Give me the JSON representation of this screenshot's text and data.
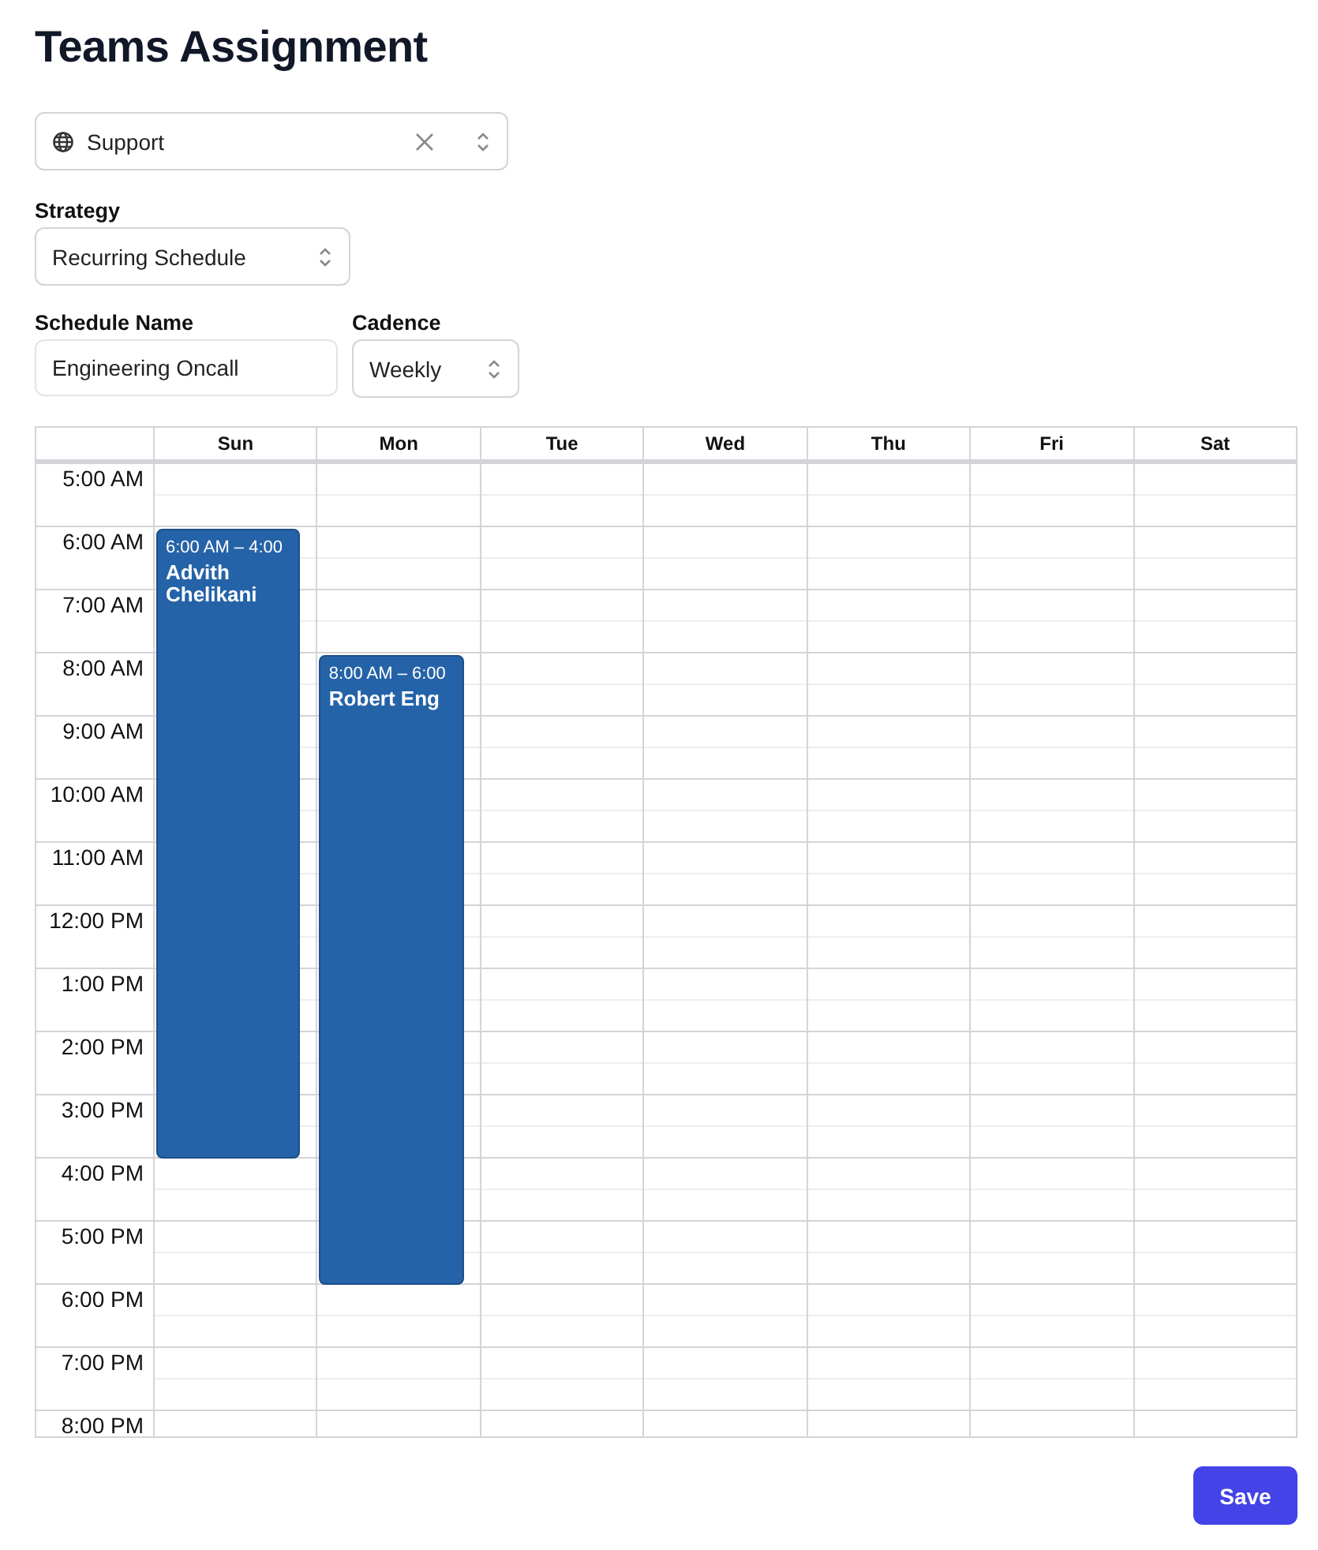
{
  "title": "Teams Assignment",
  "team_select": {
    "value": "Support"
  },
  "strategy": {
    "label": "Strategy",
    "value": "Recurring Schedule"
  },
  "schedule_name": {
    "label": "Schedule Name",
    "value": "Engineering Oncall"
  },
  "cadence": {
    "label": "Cadence",
    "value": "Weekly"
  },
  "calendar": {
    "hours": [
      "5:00 AM",
      "6:00 AM",
      "7:00 AM",
      "8:00 AM",
      "9:00 AM",
      "10:00 AM",
      "11:00 AM",
      "12:00 PM",
      "1:00 PM",
      "2:00 PM",
      "3:00 PM",
      "4:00 PM",
      "5:00 PM",
      "6:00 PM",
      "7:00 PM",
      "8:00 PM"
    ],
    "days": [
      {
        "label": "Sun",
        "slots": [
          {
            "kind": "free"
          },
          {
            "kind": "event",
            "time": "6:00 AM – 4:00",
            "name": "Advith Chelikani"
          },
          {
            "kind": "cont"
          },
          {
            "kind": "cont"
          },
          {
            "kind": "cont"
          },
          {
            "kind": "cont"
          },
          {
            "kind": "cont"
          },
          {
            "kind": "cont"
          },
          {
            "kind": "cont"
          },
          {
            "kind": "cont"
          },
          {
            "kind": "cont"
          }
        ]
      },
      {
        "label": "Mon",
        "slots": [
          {
            "kind": "free"
          },
          {
            "kind": "free"
          },
          {
            "kind": "free"
          },
          {
            "kind": "event",
            "time": "8:00 AM – 6:00",
            "name": "Robert Eng"
          },
          {
            "kind": "cont"
          },
          {
            "kind": "cont"
          },
          {
            "kind": "cont"
          },
          {
            "kind": "cont"
          },
          {
            "kind": "cont"
          },
          {
            "kind": "cont"
          },
          {
            "kind": "cont"
          },
          {
            "kind": "cont"
          },
          {
            "kind": "cont"
          }
        ]
      },
      {
        "label": "Tue"
      },
      {
        "label": "Wed"
      },
      {
        "label": "Thu"
      },
      {
        "label": "Fri"
      },
      {
        "label": "Sat"
      }
    ]
  },
  "save_button": "Save"
}
